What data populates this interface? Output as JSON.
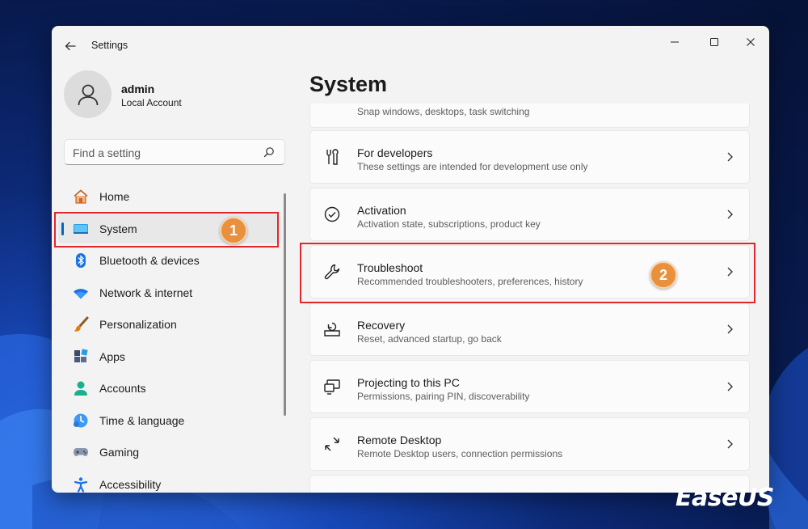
{
  "window": {
    "app_title": "Settings",
    "controls": {
      "minimize": "minimize-icon",
      "maximize": "maximize-icon",
      "close": "close-icon"
    }
  },
  "profile": {
    "name": "admin",
    "account_type": "Local Account"
  },
  "search": {
    "placeholder": "Find a setting",
    "value": ""
  },
  "sidebar": {
    "items": [
      {
        "label": "Home",
        "icon": "home-icon",
        "selected": false
      },
      {
        "label": "System",
        "icon": "system-icon",
        "selected": true
      },
      {
        "label": "Bluetooth & devices",
        "icon": "bluetooth-icon",
        "selected": false
      },
      {
        "label": "Network & internet",
        "icon": "wifi-icon",
        "selected": false
      },
      {
        "label": "Personalization",
        "icon": "brush-icon",
        "selected": false
      },
      {
        "label": "Apps",
        "icon": "apps-icon",
        "selected": false
      },
      {
        "label": "Accounts",
        "icon": "accounts-icon",
        "selected": false
      },
      {
        "label": "Time & language",
        "icon": "time-language-icon",
        "selected": false
      },
      {
        "label": "Gaming",
        "icon": "gaming-icon",
        "selected": false
      },
      {
        "label": "Accessibility",
        "icon": "accessibility-icon",
        "selected": false
      }
    ]
  },
  "main": {
    "title": "System",
    "clipped_item_desc": "Snap windows, desktops, task switching",
    "items": [
      {
        "title": "For developers",
        "desc": "These settings are intended for development use only",
        "icon": "developer-tools-icon"
      },
      {
        "title": "Activation",
        "desc": "Activation state, subscriptions, product key",
        "icon": "activation-check-icon"
      },
      {
        "title": "Troubleshoot",
        "desc": "Recommended troubleshooters, preferences, history",
        "icon": "wrench-icon"
      },
      {
        "title": "Recovery",
        "desc": "Reset, advanced startup, go back",
        "icon": "recovery-icon"
      },
      {
        "title": "Projecting to this PC",
        "desc": "Permissions, pairing PIN, discoverability",
        "icon": "projecting-icon"
      },
      {
        "title": "Remote Desktop",
        "desc": "Remote Desktop users, connection permissions",
        "icon": "remote-desktop-icon"
      }
    ]
  },
  "annotations": {
    "step1": "1",
    "step2": "2",
    "highlight_color": "#e3262c",
    "badge_color": "#e8903c"
  },
  "watermark": {
    "logo_text": "EaseUS"
  },
  "colors": {
    "accent": "#0067c0",
    "window_bg": "#f3f3f3",
    "card_bg": "#fbfbfb"
  }
}
